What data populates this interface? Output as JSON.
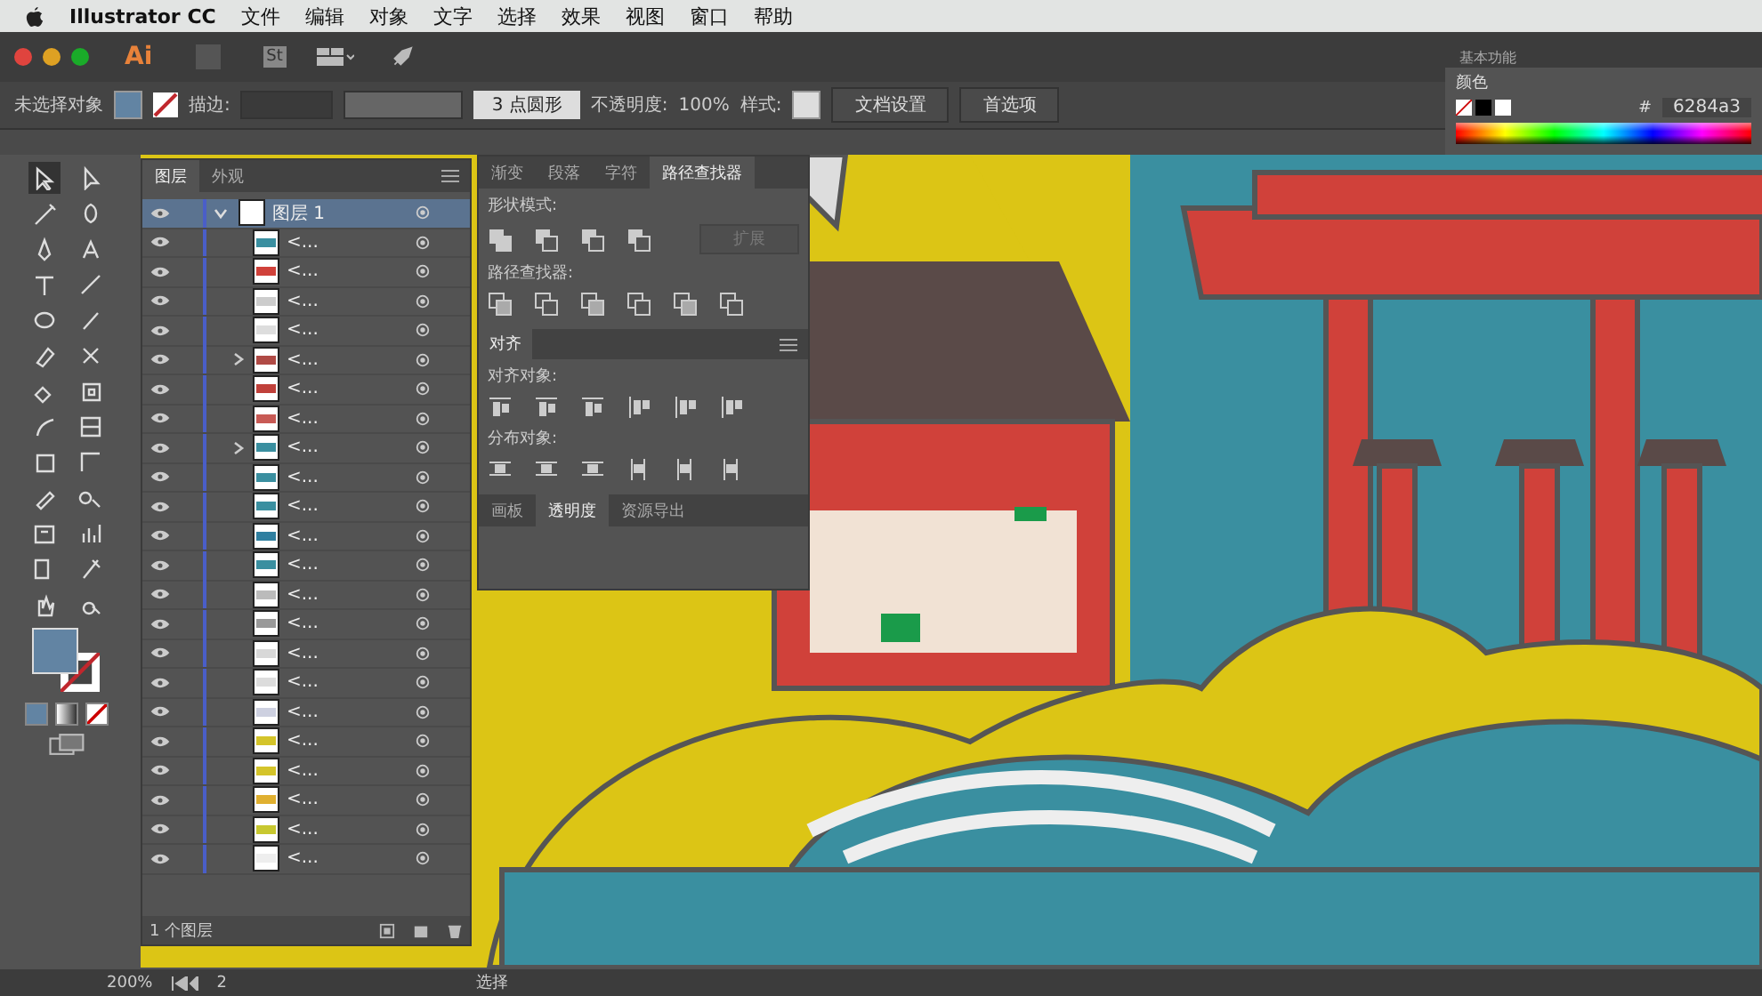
{
  "menu_bar": {
    "app_name": "Illustrator CC",
    "items": [
      "文件",
      "编辑",
      "对象",
      "文字",
      "选择",
      "效果",
      "视图",
      "窗口",
      "帮助"
    ]
  },
  "app_bar": {
    "logo": "Ai",
    "stock_label": "St",
    "workspace": "基本功能"
  },
  "control_bar": {
    "selection": "未选择对象",
    "stroke_label": "描边:",
    "brush": "3 点圆形",
    "opacity_label": "不透明度:",
    "opacity": "100%",
    "style_label": "样式:",
    "buttons": [
      "文档设置",
      "首选项"
    ]
  },
  "color_panel": {
    "title": "颜色",
    "hash": "#",
    "hex": "6284a3"
  },
  "layers_panel": {
    "tabs": [
      {
        "label": "图层",
        "selected": true
      },
      {
        "label": "外观",
        "selected": false
      }
    ],
    "layer": {
      "name": "图层 1",
      "expanded": true
    },
    "rows": [
      {
        "name": "<...",
        "expandable": false,
        "color": "#3a8fa0"
      },
      {
        "name": "<...",
        "expandable": false,
        "color": "#d0413a"
      },
      {
        "name": "<...",
        "expandable": false,
        "color": "#cccccc"
      },
      {
        "name": "<...",
        "expandable": false,
        "color": "#dddddd"
      },
      {
        "name": "<...",
        "expandable": true,
        "color": "#b04a45"
      },
      {
        "name": "<...",
        "expandable": false,
        "color": "#c0403a"
      },
      {
        "name": "<...",
        "expandable": false,
        "color": "#c85a55"
      },
      {
        "name": "<...",
        "expandable": true,
        "color": "#3a8fa0"
      },
      {
        "name": "<...",
        "expandable": false,
        "color": "#3a8fa0"
      },
      {
        "name": "<...",
        "expandable": false,
        "color": "#3a8fa0"
      },
      {
        "name": "<...",
        "expandable": false,
        "color": "#2f7fa0"
      },
      {
        "name": "<...",
        "expandable": false,
        "color": "#3a8fa0"
      },
      {
        "name": "<...",
        "expandable": false,
        "color": "#bbbbbb"
      },
      {
        "name": "<...",
        "expandable": false,
        "color": "#999999"
      },
      {
        "name": "<...",
        "expandable": false,
        "color": "#d8d8d8"
      },
      {
        "name": "<...",
        "expandable": false,
        "color": "#dcdcdc"
      },
      {
        "name": "<...",
        "expandable": false,
        "color": "#cdd0e0"
      },
      {
        "name": "<...",
        "expandable": false,
        "color": "#d4c42a"
      },
      {
        "name": "<...",
        "expandable": false,
        "color": "#d4c42a"
      },
      {
        "name": "<...",
        "expandable": false,
        "color": "#e0b030"
      },
      {
        "name": "<...",
        "expandable": false,
        "color": "#c8c830"
      },
      {
        "name": "<...",
        "expandable": false,
        "color": "#eeeeee"
      }
    ],
    "footer": "1 个图层"
  },
  "pathfinder_panel": {
    "tabs": [
      {
        "label": "渐变",
        "selected": false
      },
      {
        "label": "段落",
        "selected": false
      },
      {
        "label": "字符",
        "selected": false
      },
      {
        "label": "路径查找器",
        "selected": true
      }
    ],
    "shape_modes_label": "形状模式:",
    "expand_button": {
      "label": "扩展",
      "disabled": true
    },
    "pathfinders_label": "路径查找器:"
  },
  "align_panel": {
    "title": "对齐",
    "align_objects_label": "对齐对象:",
    "distribute_objects_label": "分布对象:",
    "bottom_tabs": [
      {
        "label": "画板",
        "selected": false
      },
      {
        "label": "透明度",
        "selected": true
      },
      {
        "label": "资源导出",
        "selected": false
      }
    ]
  },
  "status_bar": {
    "zoom": "200%",
    "artboard": "2",
    "tool": "选择"
  }
}
